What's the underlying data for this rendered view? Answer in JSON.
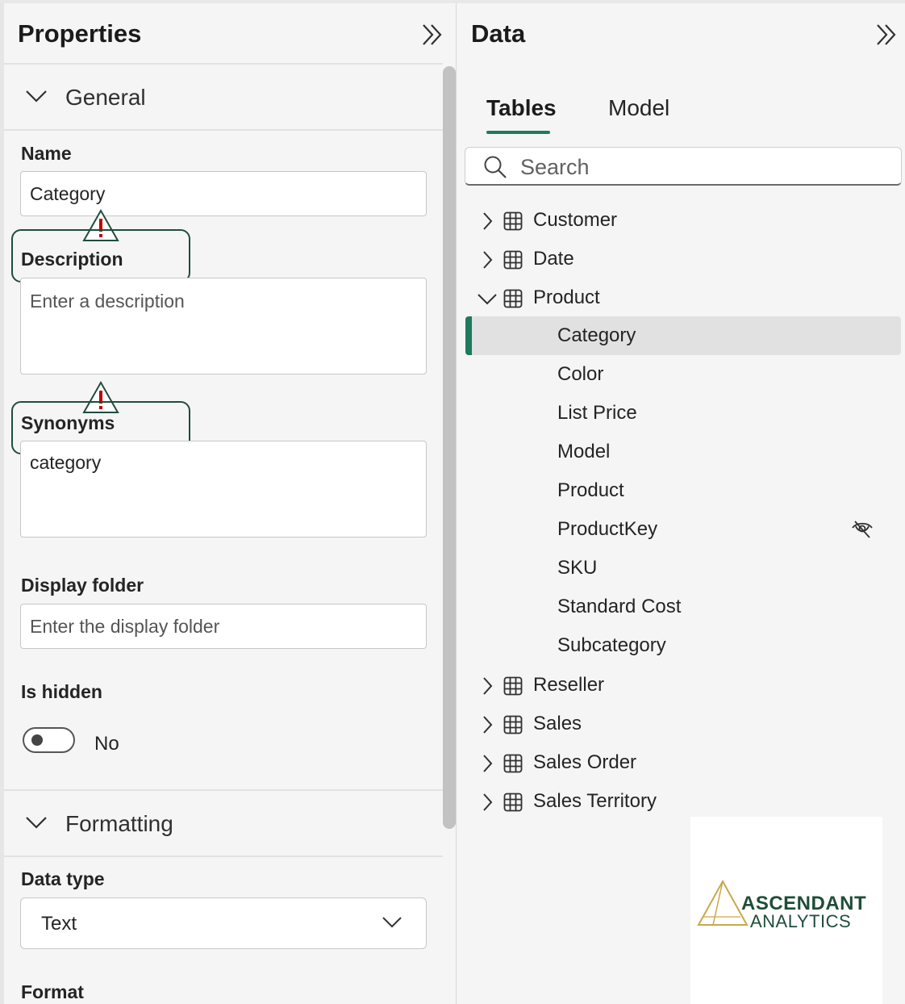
{
  "properties": {
    "title": "Properties",
    "general_section": "General",
    "name": {
      "label": "Name",
      "value": "Category"
    },
    "description": {
      "label": "Description",
      "placeholder": "Enter a description"
    },
    "synonyms": {
      "label": "Synonyms",
      "value": "category"
    },
    "display_folder": {
      "label": "Display folder",
      "placeholder": "Enter the display folder"
    },
    "is_hidden": {
      "label": "Is hidden",
      "state": "No"
    },
    "formatting_section": "Formatting",
    "data_type": {
      "label": "Data type",
      "value": "Text"
    },
    "format": {
      "label": "Format"
    }
  },
  "data_pane": {
    "title": "Data",
    "tabs": [
      {
        "label": "Tables",
        "active": true
      },
      {
        "label": "Model",
        "active": false
      }
    ],
    "search": {
      "placeholder": "Search"
    },
    "tables": [
      {
        "name": "Customer",
        "expanded": false
      },
      {
        "name": "Date",
        "expanded": false
      },
      {
        "name": "Product",
        "expanded": true,
        "fields": [
          {
            "name": "Category",
            "selected": true
          },
          {
            "name": "Color"
          },
          {
            "name": "List Price"
          },
          {
            "name": "Model"
          },
          {
            "name": "Product"
          },
          {
            "name": "ProductKey",
            "hidden": true,
            "icon": "eye-off-icon"
          },
          {
            "name": "SKU"
          },
          {
            "name": "Standard Cost"
          },
          {
            "name": "Subcategory"
          }
        ]
      },
      {
        "name": "Reseller",
        "expanded": false
      },
      {
        "name": "Sales",
        "expanded": false
      },
      {
        "name": "Sales Order",
        "expanded": false
      },
      {
        "name": "Sales Territory",
        "expanded": false
      }
    ]
  },
  "logo": {
    "line1": "ASCENDANT",
    "line2": "ANALYTICS"
  },
  "colors": {
    "accent": "#1e7a5d",
    "callout_border": "#1f4d3b",
    "warning": "#c00000",
    "logo_gold": "#c9a84c"
  }
}
